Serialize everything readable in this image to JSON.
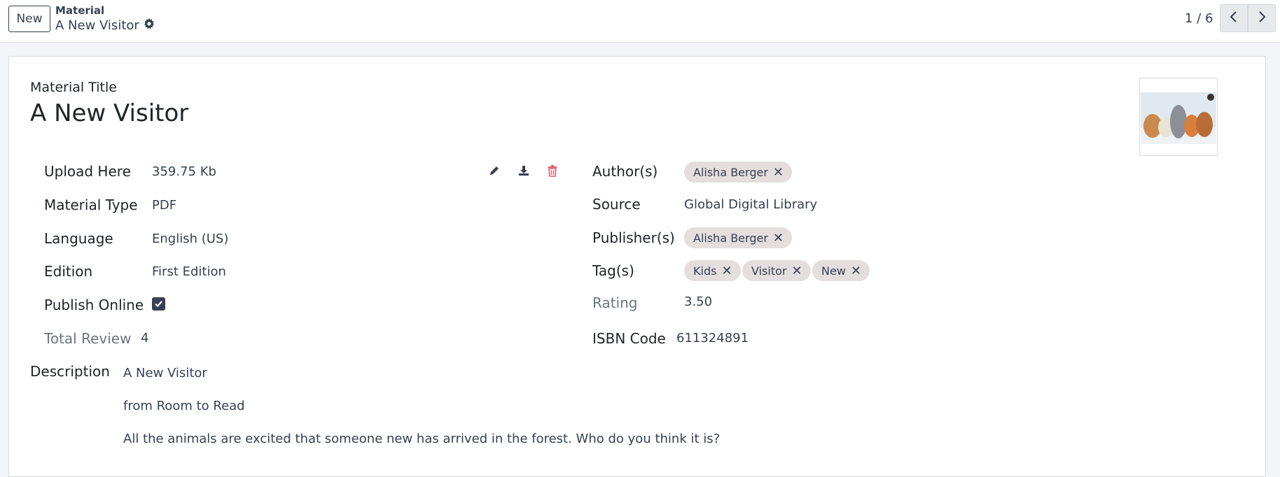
{
  "toolbar": {
    "new_label": "New"
  },
  "breadcrumb": {
    "parent": "Material",
    "current": "A New Visitor"
  },
  "pager": {
    "value": "1 / 6"
  },
  "record": {
    "title_label": "Material Title",
    "title": "A New Visitor"
  },
  "fields": {
    "upload_label": "Upload Here",
    "upload_value": "359.75 Kb",
    "material_type_label": "Material Type",
    "material_type_value": "PDF",
    "language_label": "Language",
    "language_value": "English (US)",
    "edition_label": "Edition",
    "edition_value": "First Edition",
    "publish_online_label": "Publish Online",
    "publish_online_checked": true,
    "total_review_label": "Total Review",
    "total_review_value": "4",
    "authors_label": "Author(s)",
    "authors": [
      "Alisha Berger"
    ],
    "source_label": "Source",
    "source_value": "Global Digital Library",
    "publishers_label": "Publisher(s)",
    "publishers": [
      "Alisha Berger"
    ],
    "tags_label": "Tag(s)",
    "tags": [
      "Kids",
      "Visitor",
      "New"
    ],
    "rating_label": "Rating",
    "rating_value": "3.50",
    "isbn_label": "ISBN Code",
    "isbn_value": "611324891",
    "description_label": "Description",
    "description_lines": [
      "A New Visitor",
      "from Room to Read",
      "All the animals are excited that someone new has arrived in the forest. Who do you think it is?"
    ]
  },
  "icons": {
    "settings": "gear-icon",
    "prev": "chevron-left-icon",
    "next": "chevron-right-icon",
    "edit": "pencil-icon",
    "download": "download-icon",
    "delete": "trash-icon",
    "remove_tag": "close-icon"
  },
  "colors": {
    "delete": "#e35d6a",
    "tag_bg": "#e4dede",
    "checkbox": "#374151"
  }
}
